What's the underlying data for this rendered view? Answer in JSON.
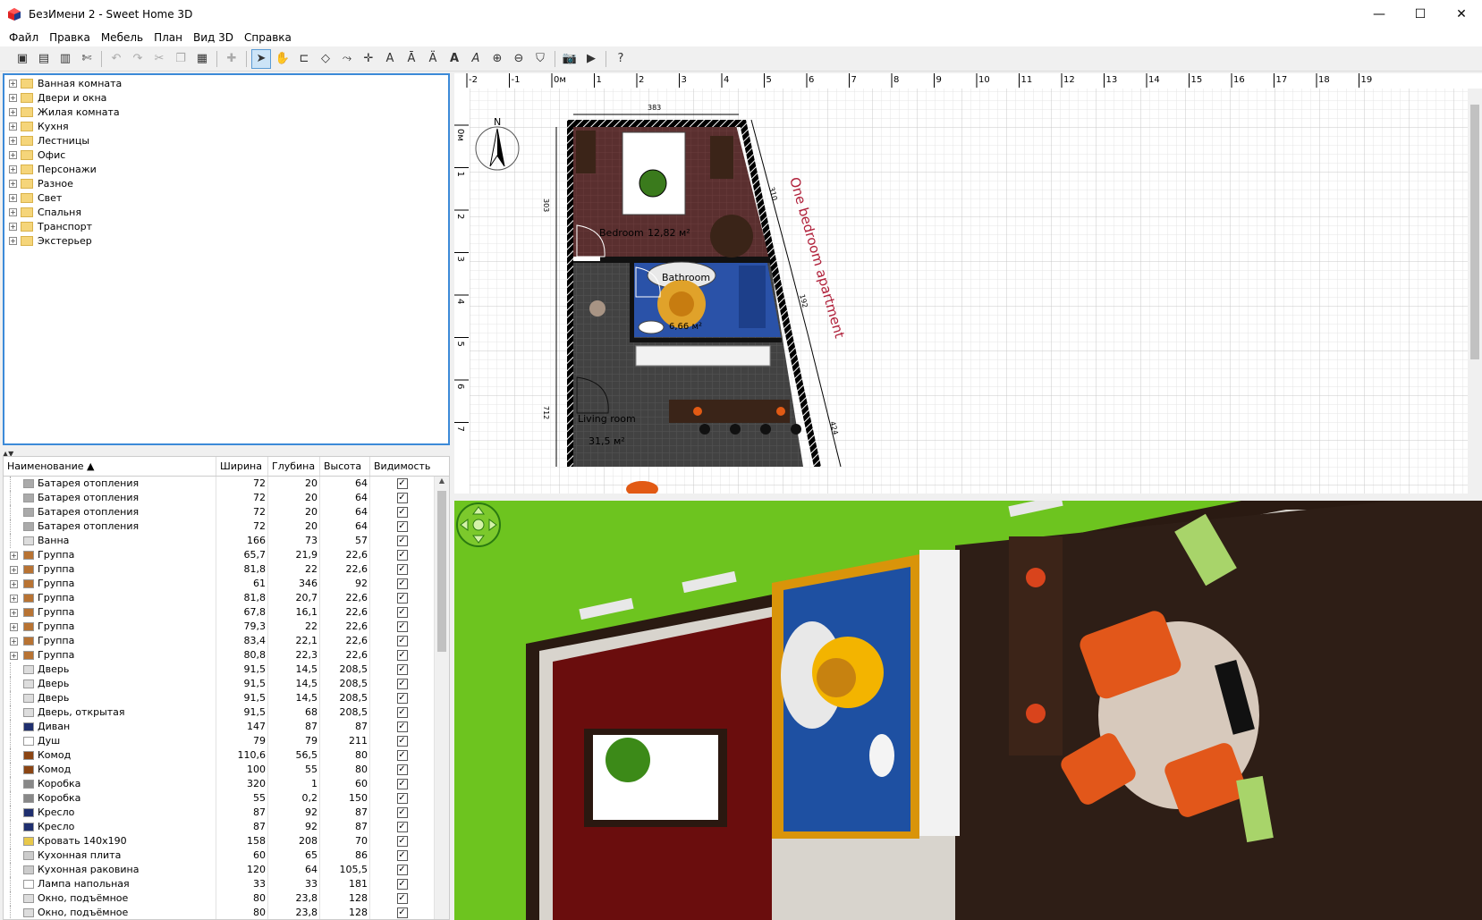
{
  "window": {
    "title": "БезИмени 2 - Sweet Home 3D"
  },
  "menu": [
    "Файл",
    "Правка",
    "Мебель",
    "План",
    "Вид 3D",
    "Справка"
  ],
  "catalog": [
    "Ванная комната",
    "Двери и окна",
    "Жилая комната",
    "Кухня",
    "Лестницы",
    "Офис",
    "Персонажи",
    "Разное",
    "Свет",
    "Спальня",
    "Транспорт",
    "Экстерьер"
  ],
  "furniture_headers": {
    "name": "Наименование ▲",
    "width": "Ширина",
    "depth": "Глубина",
    "height": "Высота",
    "visible": "Видимость"
  },
  "furniture": [
    {
      "name": "Батарея отопления",
      "w": "72",
      "d": "20",
      "h": "64",
      "icon": "#aaaaaa",
      "tree": false
    },
    {
      "name": "Батарея отопления",
      "w": "72",
      "d": "20",
      "h": "64",
      "icon": "#aaaaaa",
      "tree": false
    },
    {
      "name": "Батарея отопления",
      "w": "72",
      "d": "20",
      "h": "64",
      "icon": "#aaaaaa",
      "tree": false
    },
    {
      "name": "Батарея отопления",
      "w": "72",
      "d": "20",
      "h": "64",
      "icon": "#aaaaaa",
      "tree": false
    },
    {
      "name": "Ванна",
      "w": "166",
      "d": "73",
      "h": "57",
      "icon": "#dddddd",
      "tree": false
    },
    {
      "name": "Группа",
      "w": "65,7",
      "d": "21,9",
      "h": "22,6",
      "icon": "#b87333",
      "tree": true
    },
    {
      "name": "Группа",
      "w": "81,8",
      "d": "22",
      "h": "22,6",
      "icon": "#b87333",
      "tree": true
    },
    {
      "name": "Группа",
      "w": "61",
      "d": "346",
      "h": "92",
      "icon": "#b87333",
      "tree": true
    },
    {
      "name": "Группа",
      "w": "81,8",
      "d": "20,7",
      "h": "22,6",
      "icon": "#b87333",
      "tree": true
    },
    {
      "name": "Группа",
      "w": "67,8",
      "d": "16,1",
      "h": "22,6",
      "icon": "#b87333",
      "tree": true
    },
    {
      "name": "Группа",
      "w": "79,3",
      "d": "22",
      "h": "22,6",
      "icon": "#b87333",
      "tree": true
    },
    {
      "name": "Группа",
      "w": "83,4",
      "d": "22,1",
      "h": "22,6",
      "icon": "#b87333",
      "tree": true
    },
    {
      "name": "Группа",
      "w": "80,8",
      "d": "22,3",
      "h": "22,6",
      "icon": "#b87333",
      "tree": true
    },
    {
      "name": "Дверь",
      "w": "91,5",
      "d": "14,5",
      "h": "208,5",
      "icon": "#dddddd",
      "tree": false
    },
    {
      "name": "Дверь",
      "w": "91,5",
      "d": "14,5",
      "h": "208,5",
      "icon": "#dddddd",
      "tree": false
    },
    {
      "name": "Дверь",
      "w": "91,5",
      "d": "14,5",
      "h": "208,5",
      "icon": "#dddddd",
      "tree": false
    },
    {
      "name": "Дверь, открытая",
      "w": "91,5",
      "d": "68",
      "h": "208,5",
      "icon": "#dddddd",
      "tree": false
    },
    {
      "name": "Диван",
      "w": "147",
      "d": "87",
      "h": "87",
      "icon": "#1f2f6f",
      "tree": false
    },
    {
      "name": "Душ",
      "w": "79",
      "d": "79",
      "h": "211",
      "icon": "#ffffff",
      "tree": false
    },
    {
      "name": "Комод",
      "w": "110,6",
      "d": "56,5",
      "h": "80",
      "icon": "#8b4513",
      "tree": false
    },
    {
      "name": "Комод",
      "w": "100",
      "d": "55",
      "h": "80",
      "icon": "#8b4513",
      "tree": false
    },
    {
      "name": "Коробка",
      "w": "320",
      "d": "1",
      "h": "60",
      "icon": "#888888",
      "tree": false
    },
    {
      "name": "Коробка",
      "w": "55",
      "d": "0,2",
      "h": "150",
      "icon": "#888888",
      "tree": false
    },
    {
      "name": "Кресло",
      "w": "87",
      "d": "92",
      "h": "87",
      "icon": "#1f2f6f",
      "tree": false
    },
    {
      "name": "Кресло",
      "w": "87",
      "d": "92",
      "h": "87",
      "icon": "#1f2f6f",
      "tree": false
    },
    {
      "name": "Кровать 140x190",
      "w": "158",
      "d": "208",
      "h": "70",
      "icon": "#e8c84a",
      "tree": false
    },
    {
      "name": "Кухонная плита",
      "w": "60",
      "d": "65",
      "h": "86",
      "icon": "#cccccc",
      "tree": false
    },
    {
      "name": "Кухонная раковина",
      "w": "120",
      "d": "64",
      "h": "105,5",
      "icon": "#cccccc",
      "tree": false
    },
    {
      "name": "Лампа напольная",
      "w": "33",
      "d": "33",
      "h": "181",
      "icon": "#ffffff",
      "tree": false
    },
    {
      "name": "Окно, подъёмное",
      "w": "80",
      "d": "23,8",
      "h": "128",
      "icon": "#dddddd",
      "tree": false
    },
    {
      "name": "Окно, подъёмное",
      "w": "80",
      "d": "23,8",
      "h": "128",
      "icon": "#dddddd",
      "tree": false
    }
  ],
  "plan": {
    "ruler_x": [
      "-2",
      "-1",
      "0м",
      "1",
      "2",
      "3",
      "4",
      "5",
      "6",
      "7",
      "8",
      "9",
      "10",
      "11",
      "12",
      "13",
      "14",
      "15",
      "16",
      "17",
      "18",
      "19"
    ],
    "ruler_y": [
      "0м",
      "1",
      "2",
      "3",
      "4",
      "5",
      "6",
      "7"
    ],
    "bedroom_label": "Bedroom",
    "bedroom_area": "12,82 м²",
    "bathroom_label": "Bathroom",
    "bathroom_area": "6,66 м²",
    "living_label": "Living room",
    "living_area": "31,5 м²",
    "title_text": "One bedroom apartment",
    "dim_top": "383",
    "dim_left1": "303",
    "dim_left2": "712",
    "dim_right1": "310",
    "dim_right2": "192",
    "dim_right3": "424",
    "compass": "N"
  }
}
